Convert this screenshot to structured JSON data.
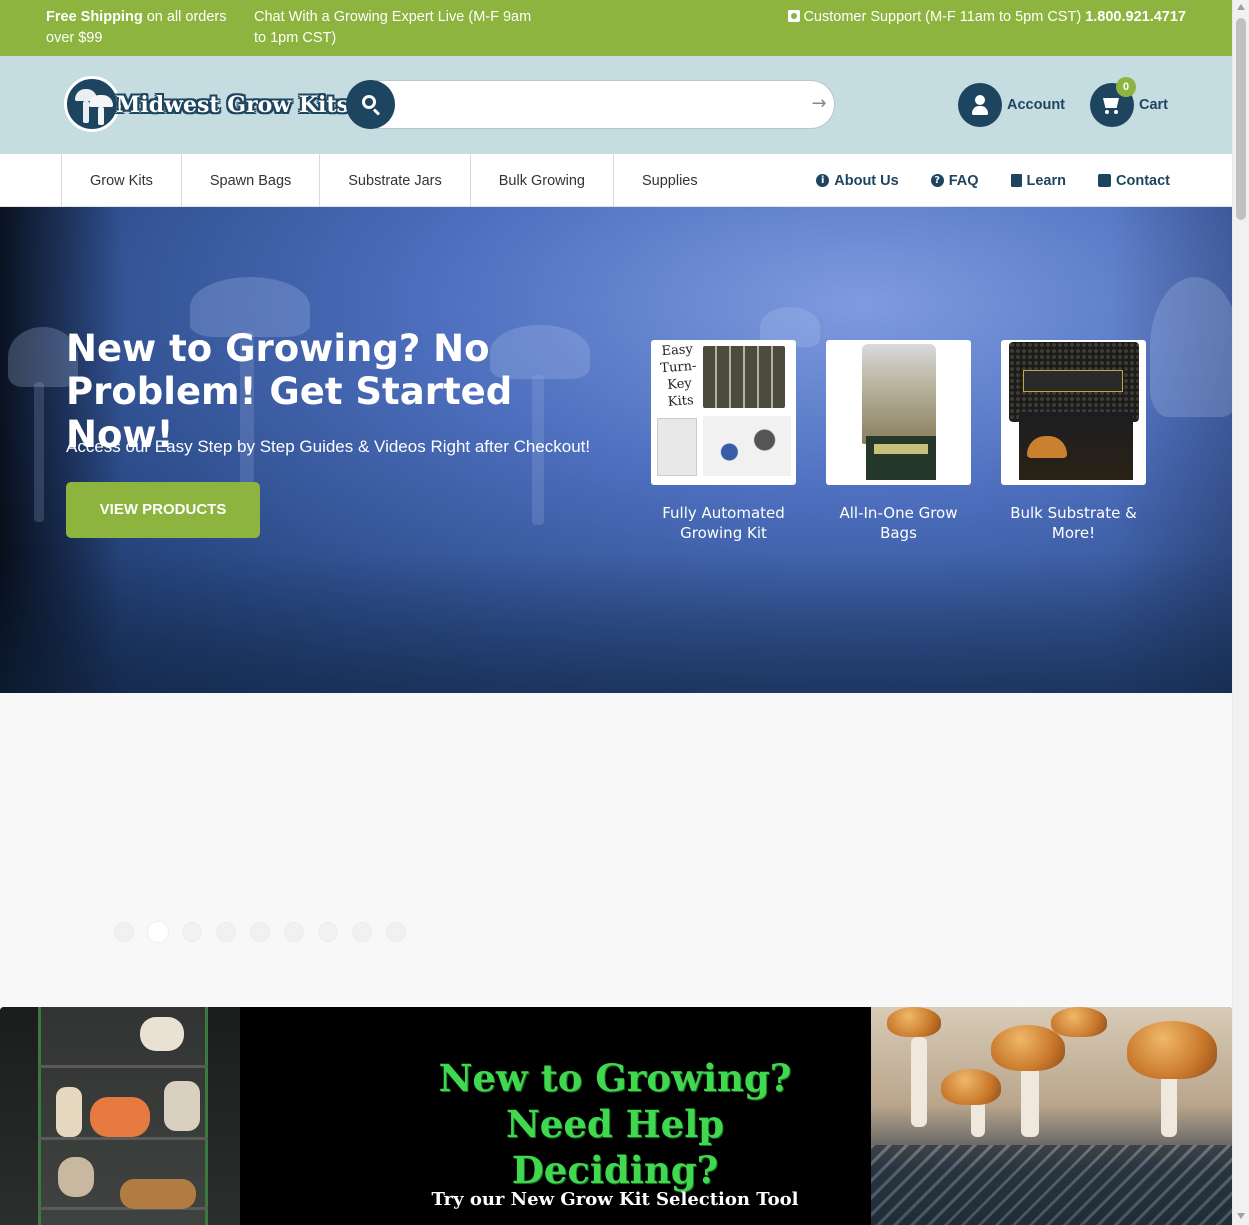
{
  "topbar": {
    "shipping_bold": "Free Shipping",
    "shipping_rest": " on all orders over $99",
    "chat": "Chat With a Growing Expert Live (M-F 9am to 1pm CST)",
    "support_label": "Customer Support (M-F 11am to 5pm CST)",
    "support_phone": "1.800.921.4717",
    "icon": "phone-icon"
  },
  "header": {
    "logo_text": "Midwest Grow Kits",
    "search": {
      "placeholder": "",
      "value": ""
    },
    "account_label": "Account",
    "cart_label": "Cart",
    "cart_count": "0"
  },
  "nav": {
    "categories": [
      "Grow Kits",
      "Spawn Bags",
      "Substrate Jars",
      "Bulk Growing",
      "Supplies"
    ],
    "links": [
      {
        "label": "About Us",
        "icon": "info-icon"
      },
      {
        "label": "FAQ",
        "icon": "question-icon"
      },
      {
        "label": "Learn",
        "icon": "book-icon"
      },
      {
        "label": "Contact",
        "icon": "phone-icon"
      }
    ]
  },
  "hero": {
    "title": "New to Growing? No Problem! Get Started Now!",
    "subtitle": "Access our Easy Step by Step Guides & Videos Right after Checkout!",
    "cta": "VIEW PRODUCTS",
    "cards": [
      {
        "caption": "Fully Automated Growing Kit",
        "image_text": "Easy Turn-Key Kits"
      },
      {
        "caption": "All-In-One Grow Bags"
      },
      {
        "caption": "Bulk Substrate & More!"
      }
    ]
  },
  "carousel": {
    "slide_count": 9,
    "active_index": 1
  },
  "promo_banner": {
    "title_line1": "New to Growing?",
    "title_line2": "Need Help Deciding?",
    "subtitle": "Try our New Grow Kit Selection Tool"
  },
  "colors": {
    "accent_green": "#8db43e",
    "brand_navy": "#1e4560",
    "header_bg": "#c5dce0",
    "banner_green_text": "#3fd84f"
  }
}
